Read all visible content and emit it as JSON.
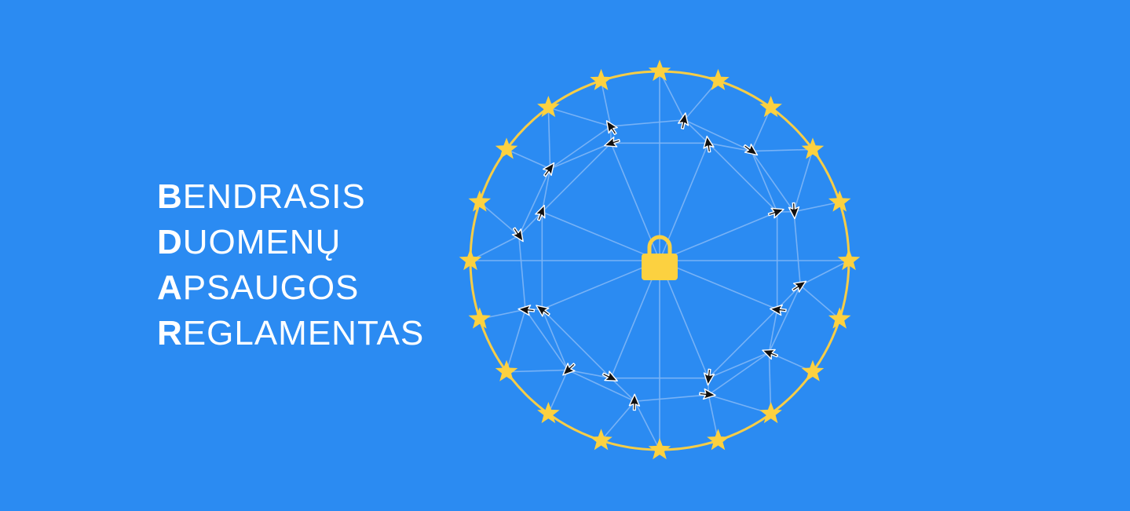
{
  "title_lines": [
    {
      "initial": "B",
      "rest": "ENDRASIS"
    },
    {
      "initial": "D",
      "rest": "UOMENŲ"
    },
    {
      "initial": "A",
      "rest": "PSAUGOS"
    },
    {
      "initial": "R",
      "rest": "EGLAMENTAS"
    }
  ],
  "colors": {
    "background": "#2b8bf2",
    "text": "#ffffff",
    "star": "#fcd140",
    "ring": "#f6cd47",
    "lock": "#fcd140",
    "network_line": "#7fb6f6",
    "cursor": "#111111"
  },
  "icons": {
    "center": "padlock-icon",
    "ring": "star-icon",
    "nodes": "mouse-cursor-icon"
  },
  "star_count": 20,
  "cursor_count": 20
}
